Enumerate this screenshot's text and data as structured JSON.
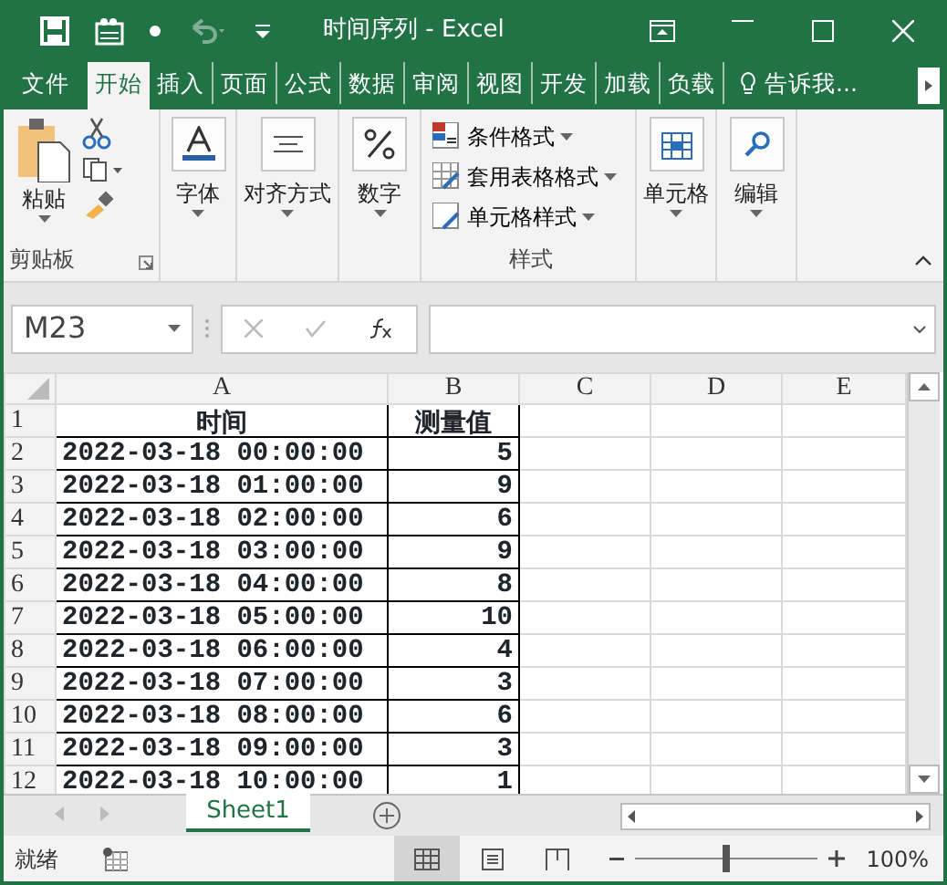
{
  "title_bar": {
    "title": "时间序列 - Excel"
  },
  "tabs": [
    {
      "label": "文件",
      "selected": false
    },
    {
      "label": "开始",
      "selected": true
    },
    {
      "label": "插入",
      "selected": false
    },
    {
      "label": "页面",
      "selected": false
    },
    {
      "label": "公式",
      "selected": false
    },
    {
      "label": "数据",
      "selected": false
    },
    {
      "label": "审阅",
      "selected": false
    },
    {
      "label": "视图",
      "selected": false
    },
    {
      "label": "开发",
      "selected": false
    },
    {
      "label": "加载",
      "selected": false
    },
    {
      "label": "负载",
      "selected": false
    },
    {
      "label": "告诉我...",
      "selected": false
    }
  ],
  "ribbon": {
    "clipboard": {
      "paste": "粘贴",
      "label": "剪贴板"
    },
    "groups": [
      {
        "kind": "font",
        "label": "字体"
      },
      {
        "kind": "align",
        "label": "对齐方式"
      },
      {
        "kind": "number",
        "label": "数字"
      }
    ],
    "styles": {
      "items": [
        "条件格式",
        "套用表格格式",
        "单元格样式"
      ],
      "label": "样式"
    },
    "tail_groups": [
      {
        "kind": "cells",
        "label": "单元格"
      },
      {
        "kind": "edit",
        "label": "编辑"
      }
    ]
  },
  "formula_bar": {
    "name_box": "M23"
  },
  "sheet": {
    "columns": [
      "A",
      "B",
      "C",
      "D",
      "E"
    ],
    "rows": [
      {
        "number": "1",
        "cells": [
          "时间",
          "测量值"
        ]
      },
      {
        "number": "2",
        "cells": [
          "2022-03-18 00:00:00",
          "5"
        ]
      },
      {
        "number": "3",
        "cells": [
          "2022-03-18 01:00:00",
          "9"
        ]
      },
      {
        "number": "4",
        "cells": [
          "2022-03-18 02:00:00",
          "6"
        ]
      },
      {
        "number": "5",
        "cells": [
          "2022-03-18 03:00:00",
          "9"
        ]
      },
      {
        "number": "6",
        "cells": [
          "2022-03-18 04:00:00",
          "8"
        ]
      },
      {
        "number": "7",
        "cells": [
          "2022-03-18 05:00:00",
          "10"
        ]
      },
      {
        "number": "8",
        "cells": [
          "2022-03-18 06:00:00",
          "4"
        ]
      },
      {
        "number": "9",
        "cells": [
          "2022-03-18 07:00:00",
          "3"
        ]
      },
      {
        "number": "10",
        "cells": [
          "2022-03-18 08:00:00",
          "6"
        ]
      },
      {
        "number": "11",
        "cells": [
          "2022-03-18 09:00:00",
          "3"
        ]
      },
      {
        "number": "12",
        "cells": [
          "2022-03-18 10:00:00",
          "1"
        ]
      }
    ]
  },
  "sheet_tabs": [
    {
      "label": "Sheet1",
      "selected": true
    }
  ],
  "status_bar": {
    "status": "就绪",
    "zoom": {
      "level": 0.5,
      "reading": "100%"
    }
  }
}
